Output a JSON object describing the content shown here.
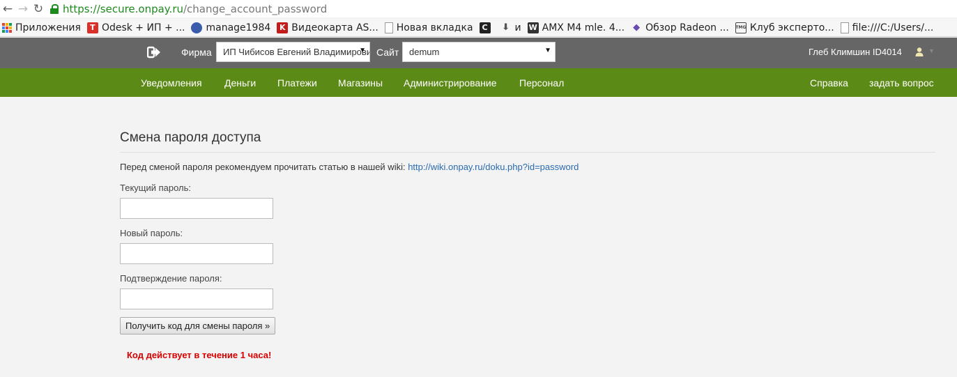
{
  "browser": {
    "url_scheme": "https://",
    "url_host": "secure.onpay.ru",
    "url_path": "/change_account_password",
    "bookmarks": [
      {
        "label": "Приложения",
        "icon": "apps-grid-icon"
      },
      {
        "label": "Odesk + ИП + ...",
        "icon": "odesk-icon",
        "glyph": "T",
        "color": "#d9302b"
      },
      {
        "label": "manage1984",
        "icon": "globe-icon",
        "color": "#3b5cad"
      },
      {
        "label": "Видеокарта AS...",
        "icon": "site-logo-icon",
        "glyph": "K",
        "color": "#c41b1b"
      },
      {
        "label": "Новая вкладка",
        "icon": "page-icon"
      },
      {
        "label": "",
        "icon": "dark-logo-icon",
        "glyph": "C",
        "color": "#222"
      },
      {
        "label": "и",
        "icon": "download-arrow-icon"
      },
      {
        "label": "AMX M4 mle. 4...",
        "icon": "tank-shield-icon",
        "glyph": "W",
        "color": "#333"
      },
      {
        "label": "Обзор Radeon ...",
        "icon": "purple-gem-icon",
        "glyph": "◆",
        "color": "#6a4bb0"
      },
      {
        "label": "Клуб эксперто...",
        "icon": "club-logo-icon",
        "glyph": "TMG",
        "color": "#444"
      },
      {
        "label": "file:///C:/Users/...",
        "icon": "file-page-icon"
      }
    ]
  },
  "header": {
    "firm_label": "Фирма",
    "firm_value": "ИП Чибисов Евгений Владимирович",
    "site_label": "Сайт",
    "site_value": "demum",
    "user_name": "Глеб Климшин ID4014"
  },
  "nav": {
    "items": [
      "Уведомления",
      "Деньги",
      "Платежи",
      "Магазины",
      "Администрирование",
      "Персонал"
    ],
    "help": "Справка",
    "ask": "задать вопрос"
  },
  "form": {
    "title": "Смена пароля доступа",
    "intro_text": "Перед сменой пароля рекомендуем прочитать статью в нашей wiki: ",
    "wiki_link": "http://wiki.onpay.ru/doku.php?id=password",
    "current_password_label": "Текущий пароль:",
    "new_password_label": "Новый пароль:",
    "confirm_password_label": "Подтверждение пароля:",
    "current_password_value": "",
    "new_password_value": "",
    "confirm_password_value": "",
    "submit_label": "Получить код для смены пароля »",
    "warning": "Код действует в течение 1 часа!"
  },
  "colors": {
    "header_bg": "#666666",
    "nav_bg": "#5c8a16",
    "link": "#2a6ab0",
    "warning": "#d60000",
    "secure_green": "#1e8a1e"
  }
}
